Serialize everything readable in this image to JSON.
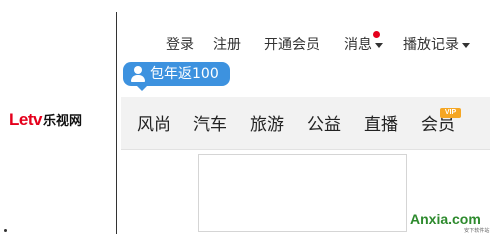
{
  "logo": {
    "brand": "Letv",
    "brand_cn": "乐视网"
  },
  "top_nav": {
    "login": "登录",
    "register": "注册",
    "open_member": "开通会员",
    "messages": "消息",
    "history": "播放记录"
  },
  "promo": {
    "label": "包年返100"
  },
  "main_nav": {
    "items": [
      "风尚",
      "汽车",
      "旅游",
      "公益",
      "直播",
      "会员"
    ],
    "vip_badge": "VIP"
  },
  "watermark": {
    "text": "Anxia.com",
    "sub": "安下软件站"
  },
  "colors": {
    "brand_red": "#e5001c",
    "promo_blue": "#3d92df",
    "vip_orange": "#f5a623",
    "watermark_green": "#2d8a2d"
  }
}
